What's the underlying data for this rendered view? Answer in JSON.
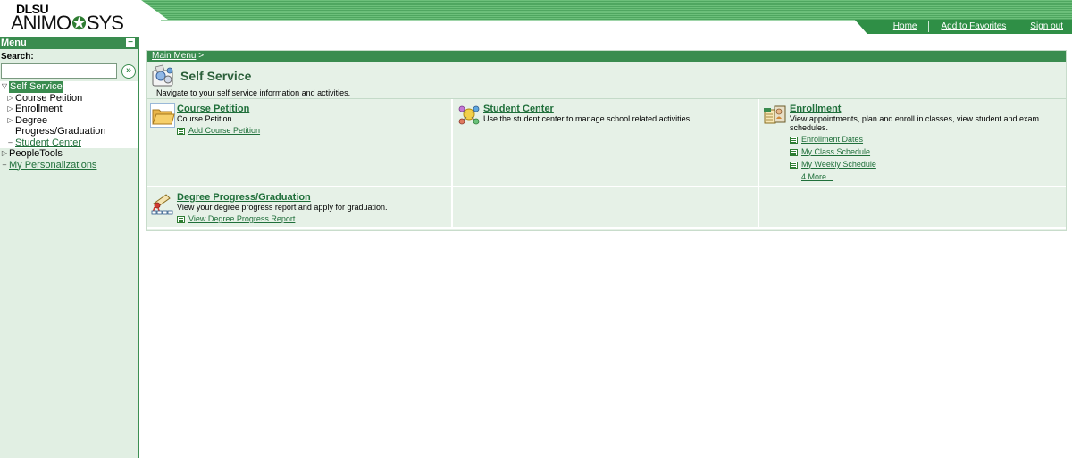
{
  "brand": {
    "logo_top": "DLSU",
    "logo_left": "ANIMO",
    "logo_right": "SYS",
    "accent": "#3a8c4f"
  },
  "header": {
    "links": [
      "Home",
      "Add to Favorites",
      "Sign out"
    ]
  },
  "sidebar": {
    "title": "Menu",
    "collapse_symbol": "−",
    "search_label": "Search:",
    "search_value": "",
    "search_go_symbol": "»",
    "self_service": "Self Service",
    "sub_items": [
      {
        "label": "Course Petition"
      },
      {
        "label": "Enrollment"
      },
      {
        "label": "Degree Progress/Graduation"
      },
      {
        "label": "Student Center"
      }
    ],
    "people_tools": "PeopleTools",
    "my_personalizations": "My Personalizations"
  },
  "main": {
    "breadcrumb": "Main Menu",
    "breadcrumb_sep": ">",
    "title": "Self Service",
    "description": "Navigate to your self service information and activities.",
    "cards": [
      {
        "title": "Course Petition",
        "description": "Course Petition",
        "links": [
          "Add Course Petition"
        ]
      },
      {
        "title": "Student Center",
        "description": "Use the student center to manage school related activities.",
        "links": []
      },
      {
        "title": "Enrollment",
        "description": "View appointments, plan and enroll in classes, view student and exam schedules.",
        "links": [
          "Enrollment Dates",
          "My Class Schedule",
          "My Weekly Schedule"
        ],
        "more": "4 More..."
      },
      {
        "title": "Degree Progress/Graduation",
        "description": "View your degree progress report and apply for graduation.",
        "links": [
          "View Degree Progress Report"
        ]
      }
    ]
  }
}
